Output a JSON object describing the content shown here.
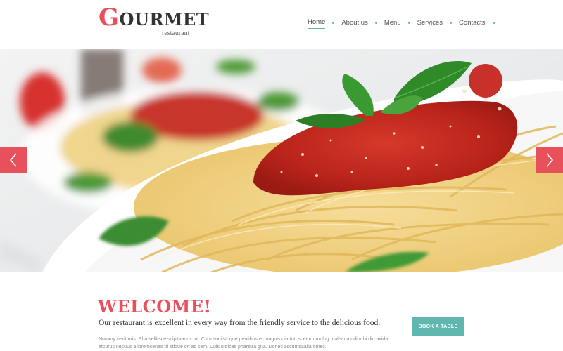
{
  "brand": {
    "logo_initial": "G",
    "logo_rest": "OURMET",
    "logo_sub": "restaurant"
  },
  "nav": {
    "items": [
      {
        "label": "Home",
        "active": true
      },
      {
        "label": "About us",
        "active": false
      },
      {
        "label": "Menu",
        "active": false
      },
      {
        "label": "Services",
        "active": false
      },
      {
        "label": "Contacts",
        "active": false
      }
    ]
  },
  "slider": {
    "prev_icon": "chevron-left-icon",
    "next_icon": "chevron-right-icon"
  },
  "main": {
    "welcome_title": "WELCOME!",
    "intro_text": "Our restaurant is excellent in every way from the friendly service to the delicious food.",
    "body_text": "Nummy nerit uris. Pha sellitsce scipitvarius mi. Cum sociistoque pentibus et magnis diartutt scetur rimulug maleada odior bi dio avida atcurus necuus a loremcenas tri stique ori ac sem. Duis ultrices pharetra gna. Donec accumsaalla omec.",
    "book_button": "BOOK A TABLE"
  },
  "colors": {
    "accent": "#e8505b",
    "teal": "#5fb7b0"
  }
}
